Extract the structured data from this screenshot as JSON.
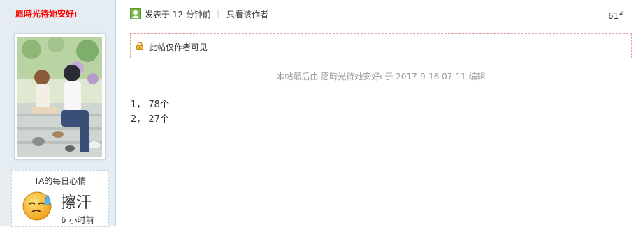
{
  "user": {
    "name": "愿時光待她安好ı"
  },
  "mood": {
    "title": "TA的每日心情",
    "name": "擦汗",
    "time": "6 小时前"
  },
  "post": {
    "posted": "发表于 12 分钟前",
    "separator": "|",
    "author_only": "只看该作者",
    "floor": "61",
    "floor_sup": "#",
    "locked_text": "此帖仅作者可见",
    "edited": "本帖最后由 愿時光待她安好ı 于 2017-9-16 07:11 编辑",
    "lines": [
      "1， 78个",
      "2， 27个"
    ]
  },
  "colors": {
    "username": "#ff0000",
    "sidebar_bg": "#e5edf2",
    "locked_border": "#e89e9e"
  }
}
